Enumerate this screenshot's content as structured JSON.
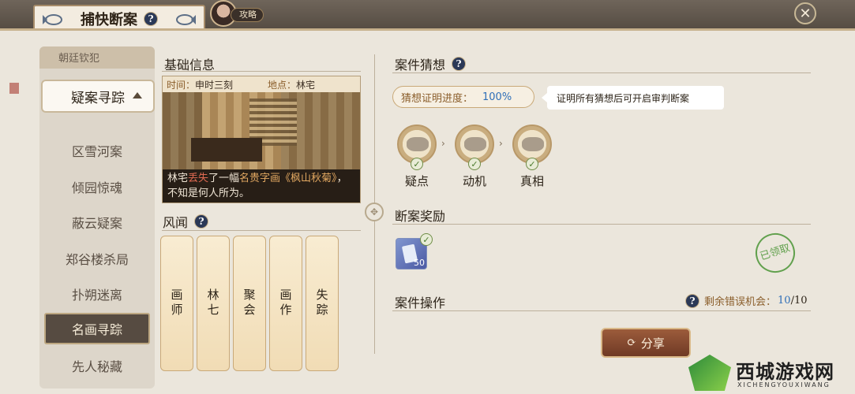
{
  "header": {
    "title": "捕快断案",
    "help": "?",
    "guide_label": "攻略",
    "close": "✕"
  },
  "case_list": {
    "top_partial": "朝廷钦犯",
    "expanded": "疑案寻踪",
    "items": [
      "区雪河案",
      "倾园惊魂",
      "蔽云疑案",
      "郑谷楼杀局",
      "扑朔迷离",
      "名画寻踪",
      "先人秘藏"
    ],
    "active_index": 5
  },
  "basic_info": {
    "title": "基础信息",
    "time_label": "时间：",
    "time_value": "申时三刻",
    "place_label": "地点：",
    "place_value": "林宅",
    "desc_prefix": "林宅",
    "desc_red": "丢失",
    "desc_mid": "了一幅",
    "desc_gold": "名贵字画《枫山秋菊》",
    "desc_suffix": "，不知是何人所为。"
  },
  "rumors": {
    "title": "风闻",
    "help": "?",
    "cards": [
      "画师",
      "林七",
      "聚会",
      "画作",
      "失踪"
    ]
  },
  "guess": {
    "title": "案件猜想",
    "help": "?",
    "progress_label": "猜想证明进度：",
    "progress_value": "100%",
    "progress_fraction": 1.0,
    "tip": "证明所有猜想后可开启审判断案",
    "clues": [
      "疑点",
      "动机",
      "真相"
    ]
  },
  "reward": {
    "title": "断案奖励",
    "item_qty": "50",
    "stamp_text": "已领取"
  },
  "operation": {
    "title": "案件操作",
    "help": "?",
    "remain_label": "剩余错误机会：",
    "remain_value": "10",
    "remain_sep": "/",
    "remain_total": "10",
    "share_label": "分享"
  },
  "watermark": {
    "name": "西城游戏网",
    "sub": "XICHENGYOUXIWANG"
  },
  "colors": {
    "accent_blue": "#2f6fb8",
    "check_green": "#4a7a2c",
    "share_brown": "#7f4329"
  }
}
